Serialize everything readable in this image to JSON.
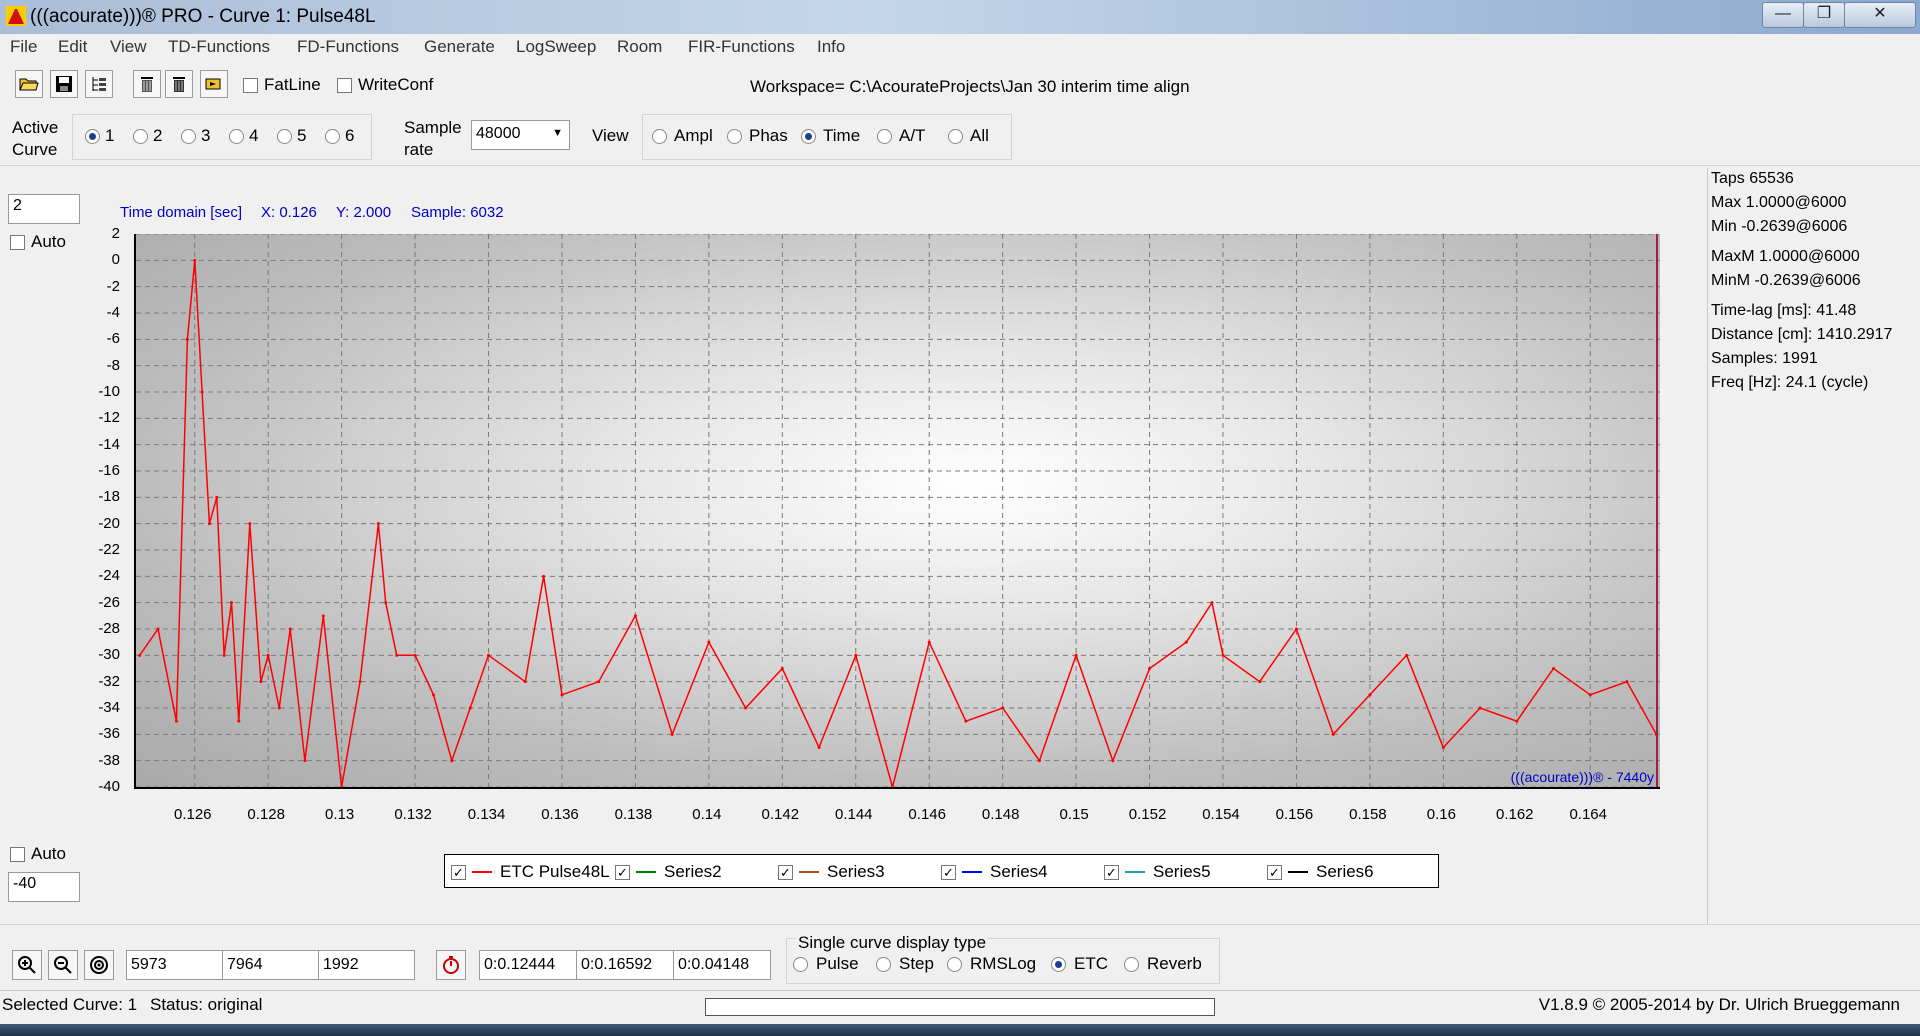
{
  "window": {
    "title": "(((acourate)))® PRO - Curve 1: Pulse48L",
    "minimize": "—",
    "maximize": "❐",
    "close": "✕"
  },
  "menu": [
    "File",
    "Edit",
    "View",
    "TD-Functions",
    "FD-Functions",
    "Generate",
    "LogSweep",
    "Room",
    "FIR-Functions",
    "Info"
  ],
  "toolbar": {
    "icons": [
      "open-folder-icon",
      "save-disk-icon",
      "tree-list-icon",
      "trash-bin-icon",
      "trash-all-icon",
      "run-macro-icon"
    ],
    "fatline_label": "FatLine",
    "fatline_checked": false,
    "writeconf_label": "WriteConf",
    "writeconf_checked": false,
    "workspace": "Workspace= C:\\AcourateProjects\\Jan 30 interim time align"
  },
  "active_curve": {
    "label_1": "Active",
    "label_2": "Curve",
    "options": [
      "1",
      "2",
      "3",
      "4",
      "5",
      "6"
    ],
    "selected": "1"
  },
  "sample_rate": {
    "label_1": "Sample",
    "label_2": "rate",
    "value": "48000"
  },
  "view": {
    "label": "View",
    "options": [
      "Ampl",
      "Phas",
      "Time",
      "A/T",
      "All"
    ],
    "selected": "Time"
  },
  "plot": {
    "ymax_field": "2",
    "ymin_field": "-40",
    "auto_label": "Auto",
    "readout": {
      "domain": "Time domain [sec]",
      "x": "X: 0.126",
      "y": "Y: 2.000",
      "sample": "Sample: 6032"
    },
    "watermark": "(((acourate)))® - 7440y"
  },
  "chart_data": {
    "type": "line",
    "xlabel": "",
    "ylabel": "",
    "xlim": [
      0.1244,
      0.1659
    ],
    "ylim": [
      -40,
      2
    ],
    "x_ticks": [
      "0.126",
      "0.128",
      "0.13",
      "0.132",
      "0.134",
      "0.136",
      "0.138",
      "0.14",
      "0.142",
      "0.144",
      "0.146",
      "0.148",
      "0.15",
      "0.152",
      "0.154",
      "0.156",
      "0.158",
      "0.16",
      "0.162",
      "0.164"
    ],
    "y_ticks": [
      "2",
      "0",
      "-2",
      "-4",
      "-6",
      "-8",
      "-10",
      "-12",
      "-14",
      "-16",
      "-18",
      "-20",
      "-22",
      "-24",
      "-26",
      "-28",
      "-30",
      "-32",
      "-34",
      "-36",
      "-38",
      "-40"
    ],
    "grid": true,
    "series": [
      {
        "name": "ETC Pulse48L",
        "color": "#ff0000",
        "x": [
          0.1245,
          0.125,
          0.1255,
          0.1258,
          0.126,
          0.1262,
          0.1264,
          0.1266,
          0.1268,
          0.127,
          0.1272,
          0.1275,
          0.1278,
          0.128,
          0.1283,
          0.1286,
          0.129,
          0.1295,
          0.13,
          0.1305,
          0.131,
          0.1312,
          0.1315,
          0.132,
          0.1325,
          0.133,
          0.1335,
          0.134,
          0.135,
          0.1355,
          0.136,
          0.137,
          0.138,
          0.139,
          0.14,
          0.141,
          0.142,
          0.143,
          0.144,
          0.145,
          0.146,
          0.147,
          0.148,
          0.149,
          0.15,
          0.151,
          0.152,
          0.153,
          0.1537,
          0.154,
          0.155,
          0.156,
          0.157,
          0.158,
          0.159,
          0.16,
          0.161,
          0.162,
          0.163,
          0.164,
          0.165,
          0.1658
        ],
        "values": [
          -30,
          -28,
          -35,
          -6,
          0,
          -10,
          -20,
          -18,
          -30,
          -26,
          -35,
          -20,
          -32,
          -30,
          -34,
          -28,
          -38,
          -27,
          -40,
          -32,
          -20,
          -26,
          -30,
          -30,
          -33,
          -38,
          -34,
          -30,
          -32,
          -24,
          -33,
          -32,
          -27,
          -36,
          -29,
          -34,
          -31,
          -37,
          -30,
          -40,
          -29,
          -35,
          -34,
          -38,
          -30,
          -38,
          -31,
          -29,
          -26,
          -30,
          -32,
          -28,
          -36,
          -33,
          -30,
          -37,
          -34,
          -35,
          -31,
          -33,
          -32,
          -36
        ]
      },
      {
        "name": "Series2",
        "color": "#008000",
        "x": [],
        "values": []
      },
      {
        "name": "Series3",
        "color": "#b05020",
        "x": [],
        "values": []
      },
      {
        "name": "Series4",
        "color": "#0000ff",
        "x": [],
        "values": []
      },
      {
        "name": "Series5",
        "color": "#20a0a0",
        "x": [],
        "values": []
      },
      {
        "name": "Series6",
        "color": "#000000",
        "x": [],
        "values": []
      }
    ],
    "legend": "bottom"
  },
  "right_panel": {
    "lines_a": [
      "Taps 65536",
      "Max 1.0000@6000",
      "Min -0.2639@6006"
    ],
    "lines_b": [
      "MaxM 1.0000@6000",
      "MinM -0.2639@6006"
    ],
    "lines_c": [
      "Time-lag [ms]: 41.48",
      "Distance [cm]: 1410.2917",
      "Samples:  1991",
      "Freq [Hz]: 24.1 (cycle)"
    ]
  },
  "bottom": {
    "sample_fields": [
      "5973",
      "7964",
      "1992"
    ],
    "time_fields": [
      "0:0.12444",
      "0:0.16592",
      "0:0.04148"
    ],
    "display_type_label": "Single curve display type",
    "display_types": [
      "Pulse",
      "Step",
      "RMSLog",
      "ETC",
      "Reverb"
    ],
    "display_selected": "ETC"
  },
  "status": {
    "selected": "Selected Curve: 1",
    "state": "Status: original",
    "version": "V1.8.9 © 2005-2014 by Dr. Ulrich Brueggemann"
  }
}
